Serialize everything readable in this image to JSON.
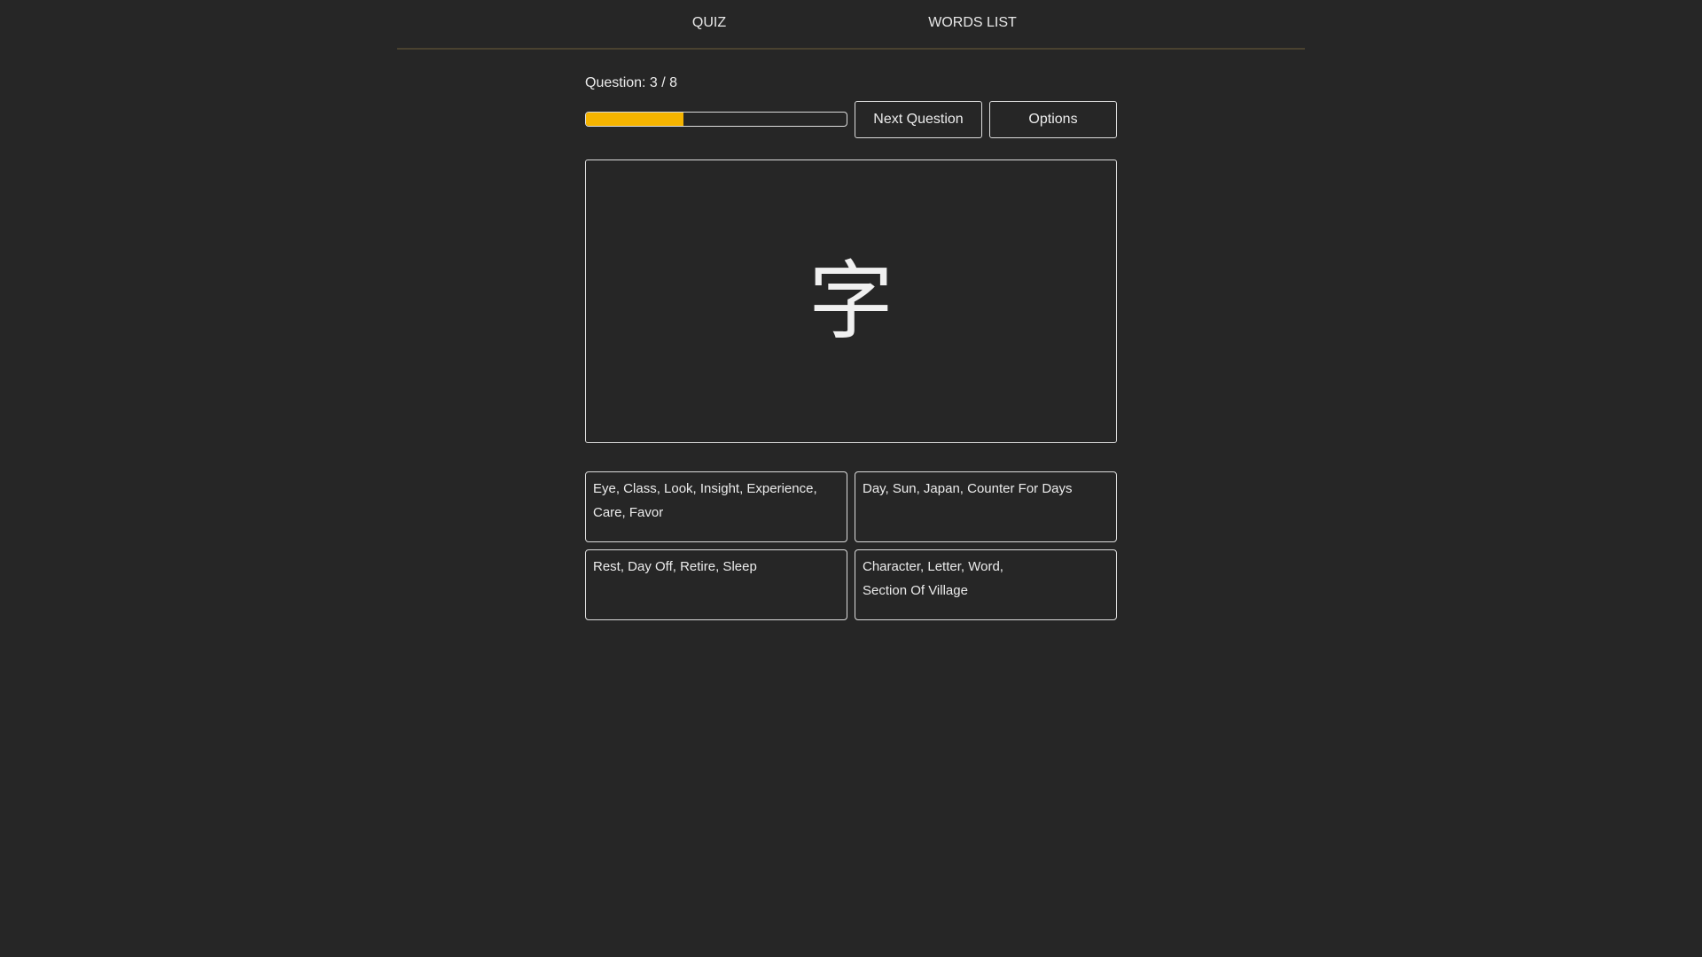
{
  "nav": {
    "items": [
      {
        "label": "QUIZ"
      },
      {
        "label": "WORDS LIST"
      }
    ]
  },
  "quiz": {
    "question_label": "Question: 3 / 8",
    "progress": 0.375,
    "progress_color": "#f5b400",
    "next_label": "Next Question",
    "options_label": "Options",
    "kanji": "字",
    "answers": [
      {
        "line1": "Eye, Class, Look, Insight, Experience,",
        "line2": "Care, Favor"
      },
      {
        "line1": "Day, Sun, Japan, Counter For Days",
        "line2": ""
      },
      {
        "line1": "Rest, Day Off, Retire, Sleep",
        "line2": ""
      },
      {
        "line1": "Character, Letter, Word,",
        "line2": "Section Of Village"
      }
    ]
  }
}
